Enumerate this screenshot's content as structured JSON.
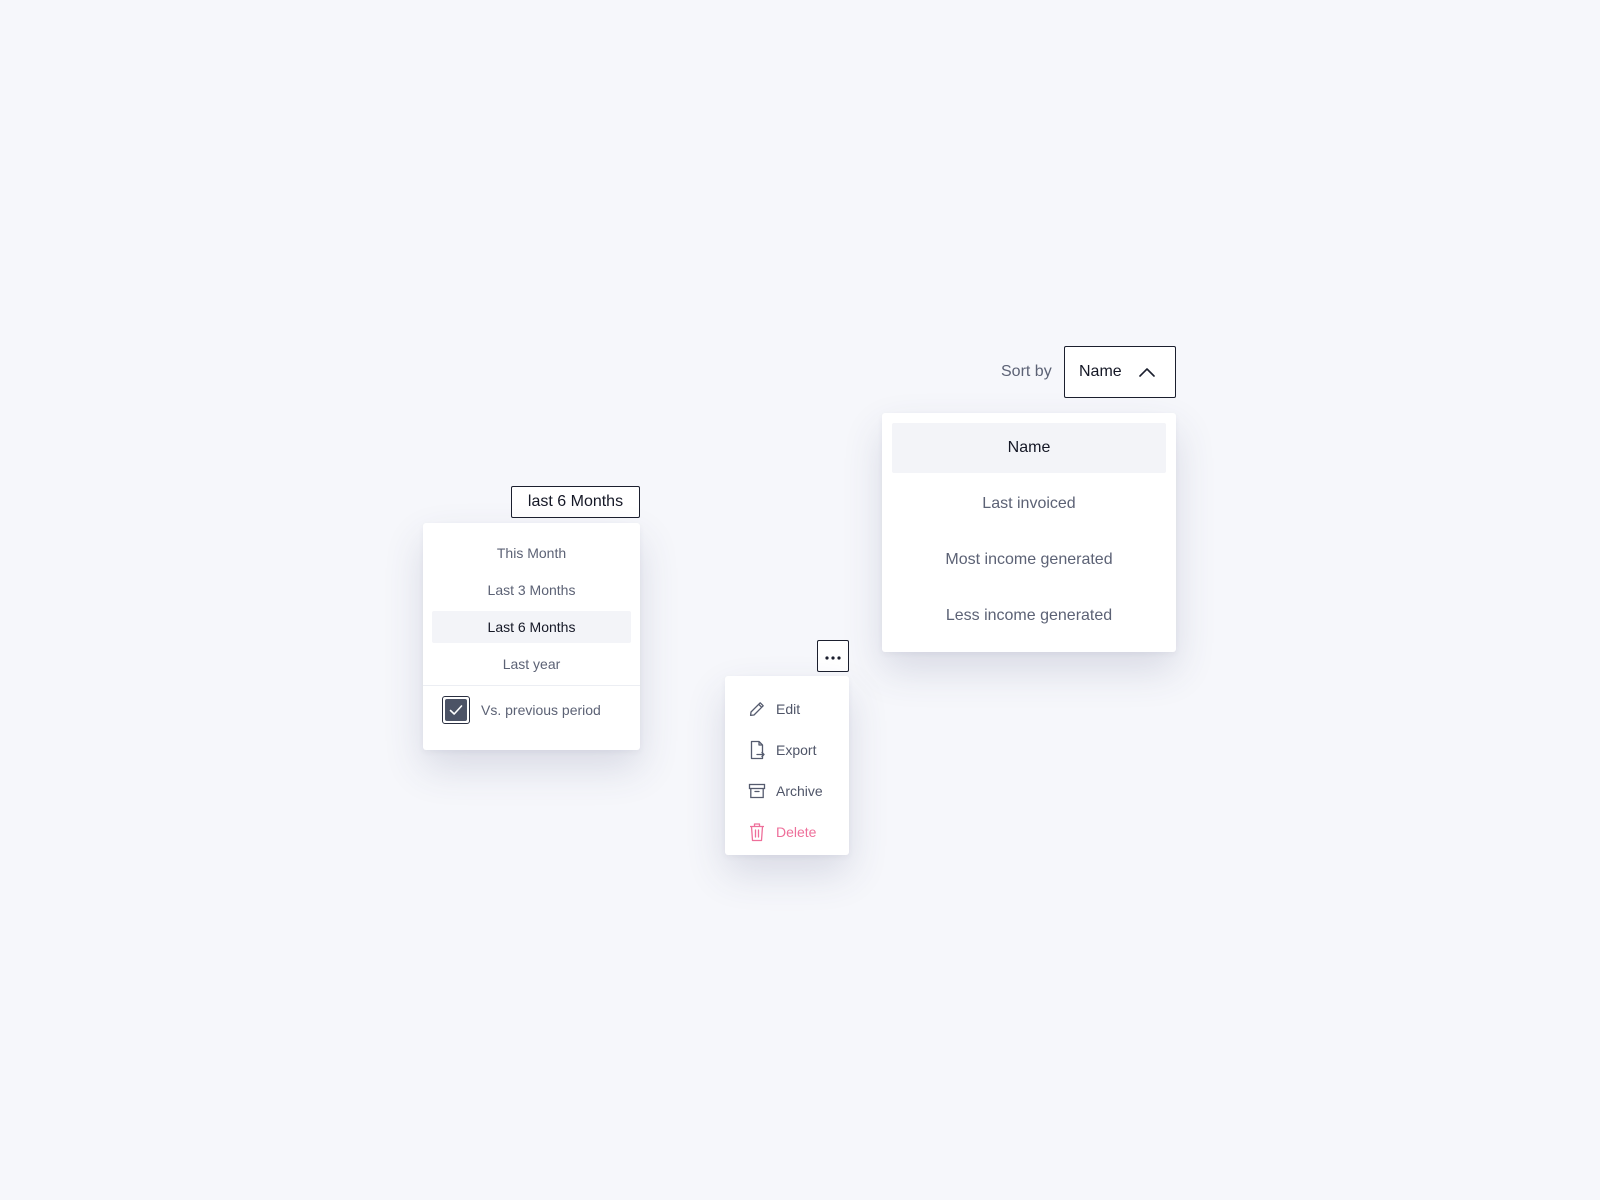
{
  "period_dropdown": {
    "selected_label": "last 6 Months",
    "options": [
      {
        "label": "This Month",
        "selected": false
      },
      {
        "label": "Last 3 Months",
        "selected": false
      },
      {
        "label": "Last 6 Months",
        "selected": true
      },
      {
        "label": "Last year",
        "selected": false
      }
    ],
    "compare": {
      "label": "Vs. previous period",
      "checked": true
    }
  },
  "action_menu": {
    "trigger_icon": "more-horizontal-icon",
    "items": [
      {
        "label": "Edit",
        "icon": "pencil-icon",
        "danger": false
      },
      {
        "label": "Export",
        "icon": "file-export-icon",
        "danger": false
      },
      {
        "label": "Archive",
        "icon": "archive-box-icon",
        "danger": false
      },
      {
        "label": "Delete",
        "icon": "trash-icon",
        "danger": true
      }
    ]
  },
  "sort_dropdown": {
    "label": "Sort by",
    "selected_label": "Name",
    "options": [
      {
        "label": "Name",
        "selected": true
      },
      {
        "label": "Last invoiced",
        "selected": false
      },
      {
        "label": "Most income generated",
        "selected": false
      },
      {
        "label": "Less income generated",
        "selected": false
      }
    ]
  },
  "colors": {
    "background": "#f6f7fb",
    "border_dark": "#1b1f2e",
    "text_muted": "#5c6275",
    "selected_bg": "#f3f4f8",
    "danger": "#ee6f9a",
    "checkbox_fill": "#4c5366"
  }
}
